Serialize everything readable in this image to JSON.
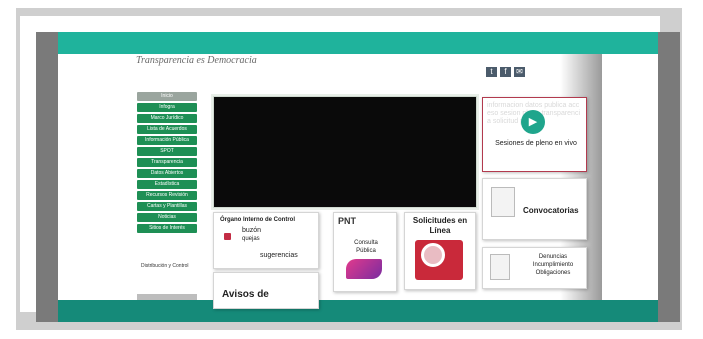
{
  "header": {
    "tagline": "Transparencia es Democracia",
    "social_icons": [
      "twitter-icon",
      "facebook-icon",
      "mail-icon"
    ]
  },
  "sidebar": {
    "items": [
      {
        "label": "Inicio",
        "active": true
      },
      {
        "label": "Infogra"
      },
      {
        "label": "Marco Jurídico"
      },
      {
        "label": "Lista de Acuerdos"
      },
      {
        "label": "Información Pública"
      },
      {
        "label": "SPOT"
      },
      {
        "label": "Transparencia"
      },
      {
        "label": "Datos Abiertos"
      },
      {
        "label": "Estadística"
      },
      {
        "label": "Recursos Revisión"
      },
      {
        "label": "Cartas y Plantillas"
      },
      {
        "label": "Noticias"
      },
      {
        "label": "Sitios de Interés"
      }
    ],
    "small_text": "Distribución y Control"
  },
  "cards": {
    "sesiones": "Sesiones de pleno en vivo",
    "convocatorias": "Convocatorias",
    "denuncias": "Denuncias Incumplimiento Obligaciones",
    "organo_title": "Órgano Interno de Control",
    "organo_buzon": "buzón",
    "organo_quejas": "quejas",
    "organo_sugerencias": "sugerencias",
    "pnt_title": "PNT",
    "pnt_sub": "Consulta Pública",
    "solicitudes": "Solicitudes en Línea",
    "avisos": "Avisos de"
  },
  "colors": {
    "accent": "#1fb39c",
    "accent_dark": "#158a79",
    "nav_green": "#1e8f55"
  }
}
